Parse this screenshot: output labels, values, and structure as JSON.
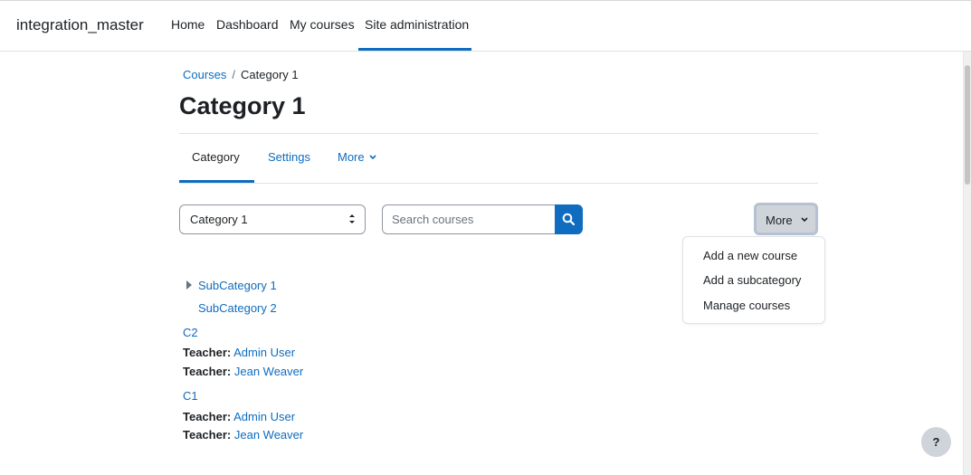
{
  "navbar": {
    "brand": "integration_master",
    "items": [
      {
        "label": "Home"
      },
      {
        "label": "Dashboard"
      },
      {
        "label": "My courses"
      },
      {
        "label": "Site administration"
      }
    ]
  },
  "breadcrumb": {
    "root": "Courses",
    "separator": "/",
    "current": "Category 1"
  },
  "page": {
    "title": "Category 1"
  },
  "secondary_nav": {
    "tabs": [
      {
        "label": "Category"
      },
      {
        "label": "Settings"
      },
      {
        "label": "More"
      }
    ]
  },
  "controls": {
    "category_select_value": "Category 1",
    "search_placeholder": "Search courses",
    "more_label": "More",
    "more_menu": [
      {
        "label": "Add a new course"
      },
      {
        "label": "Add a subcategory"
      },
      {
        "label": "Manage courses"
      }
    ]
  },
  "subcategories": [
    {
      "label": "SubCategory 1"
    },
    {
      "label": "SubCategory 2"
    }
  ],
  "courses": [
    {
      "name": "C2",
      "teachers": [
        {
          "role": "Teacher:",
          "name": "Admin User"
        },
        {
          "role": "Teacher:",
          "name": "Jean Weaver"
        }
      ]
    },
    {
      "name": "C1",
      "teachers": [
        {
          "role": "Teacher:",
          "name": "Admin User"
        },
        {
          "role": "Teacher:",
          "name": "Jean Weaver"
        }
      ]
    }
  ],
  "help": {
    "label": "?"
  },
  "colors": {
    "link": "#0f6cbf",
    "primary": "#0f6cbf",
    "text": "#1d2125",
    "secondary_button": "#ced4da"
  }
}
